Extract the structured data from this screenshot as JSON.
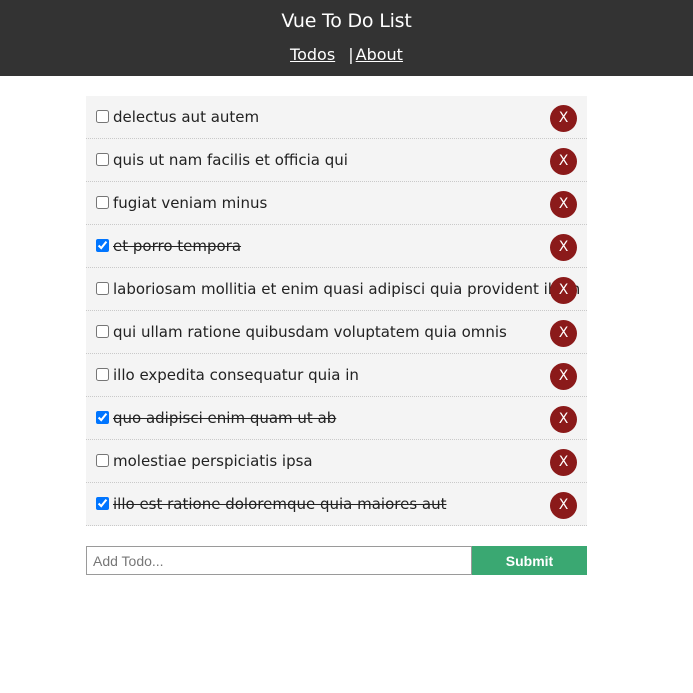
{
  "header": {
    "title": "Vue To Do List",
    "nav": {
      "todos": "Todos",
      "separator": "|",
      "about": "About"
    }
  },
  "todos": [
    {
      "title": "delectus aut autem",
      "completed": false,
      "delete_label": "X"
    },
    {
      "title": "quis ut nam facilis et officia qui",
      "completed": false,
      "delete_label": "X"
    },
    {
      "title": "fugiat veniam minus",
      "completed": false,
      "delete_label": "X"
    },
    {
      "title": "et porro tempora",
      "completed": true,
      "delete_label": "X"
    },
    {
      "title": "laboriosam mollitia et enim quasi adipisci quia provident illum",
      "completed": false,
      "delete_label": "X"
    },
    {
      "title": "qui ullam ratione quibusdam voluptatem quia omnis",
      "completed": false,
      "delete_label": "X"
    },
    {
      "title": "illo expedita consequatur quia in",
      "completed": false,
      "delete_label": "X"
    },
    {
      "title": "quo adipisci enim quam ut ab",
      "completed": true,
      "delete_label": "X"
    },
    {
      "title": "molestiae perspiciatis ipsa",
      "completed": false,
      "delete_label": "X"
    },
    {
      "title": "illo est ratione doloremque quia maiores aut",
      "completed": true,
      "delete_label": "X"
    }
  ],
  "add_todo": {
    "placeholder": "Add Todo...",
    "value": "",
    "submit_label": "Submit"
  },
  "colors": {
    "header_bg": "#333333",
    "delete_button": "#8b1a1a",
    "submit_button": "#3aa872",
    "item_bg": "#f4f4f4"
  },
  "icons": {
    "delete": "close-icon",
    "checkbox": "checkbox-icon"
  }
}
